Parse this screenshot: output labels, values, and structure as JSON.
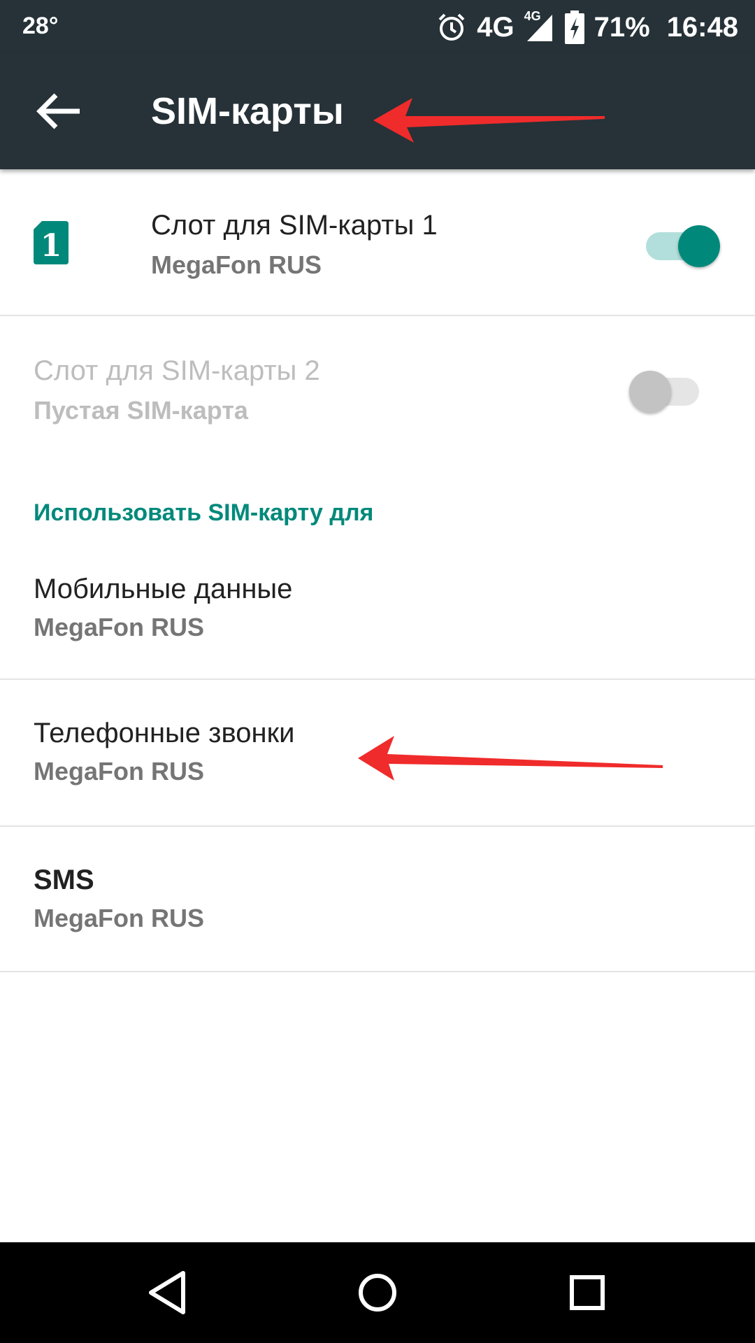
{
  "status_bar": {
    "temperature": "28°",
    "network": "4G",
    "network_small": "4G",
    "battery": "71%",
    "time": "16:48",
    "icons": [
      "alarm-icon",
      "signal-icon",
      "battery-charging-icon"
    ]
  },
  "toolbar": {
    "back_icon": "arrow-left-icon",
    "title": "SIM-карты"
  },
  "sim_slots": [
    {
      "title": "Слот для SIM-карты 1",
      "subtitle": "MegaFon RUS",
      "enabled": true,
      "switch_on": true,
      "icon": "sim-1-icon",
      "icon_label": "1"
    },
    {
      "title": "Слот для SIM-карты 2",
      "subtitle": "Пустая SIM-карта",
      "enabled": false,
      "switch_on": false
    }
  ],
  "preferences": {
    "header": "Использовать SIM-карту для",
    "items": [
      {
        "title": "Мобильные данные",
        "subtitle": "MegaFon RUS"
      },
      {
        "title": "Телефонные звонки",
        "subtitle": "MegaFon RUS"
      },
      {
        "title": "SMS",
        "subtitle": "MegaFon RUS"
      }
    ]
  },
  "annotations": {
    "arrow_color": "#f02b2b"
  },
  "nav_bar": {
    "buttons": [
      "back-triangle-icon",
      "home-circle-icon",
      "recents-square-icon"
    ]
  },
  "colors": {
    "toolbar": "#263238",
    "accent": "#00897b",
    "accent_light": "#b2dfdb"
  }
}
